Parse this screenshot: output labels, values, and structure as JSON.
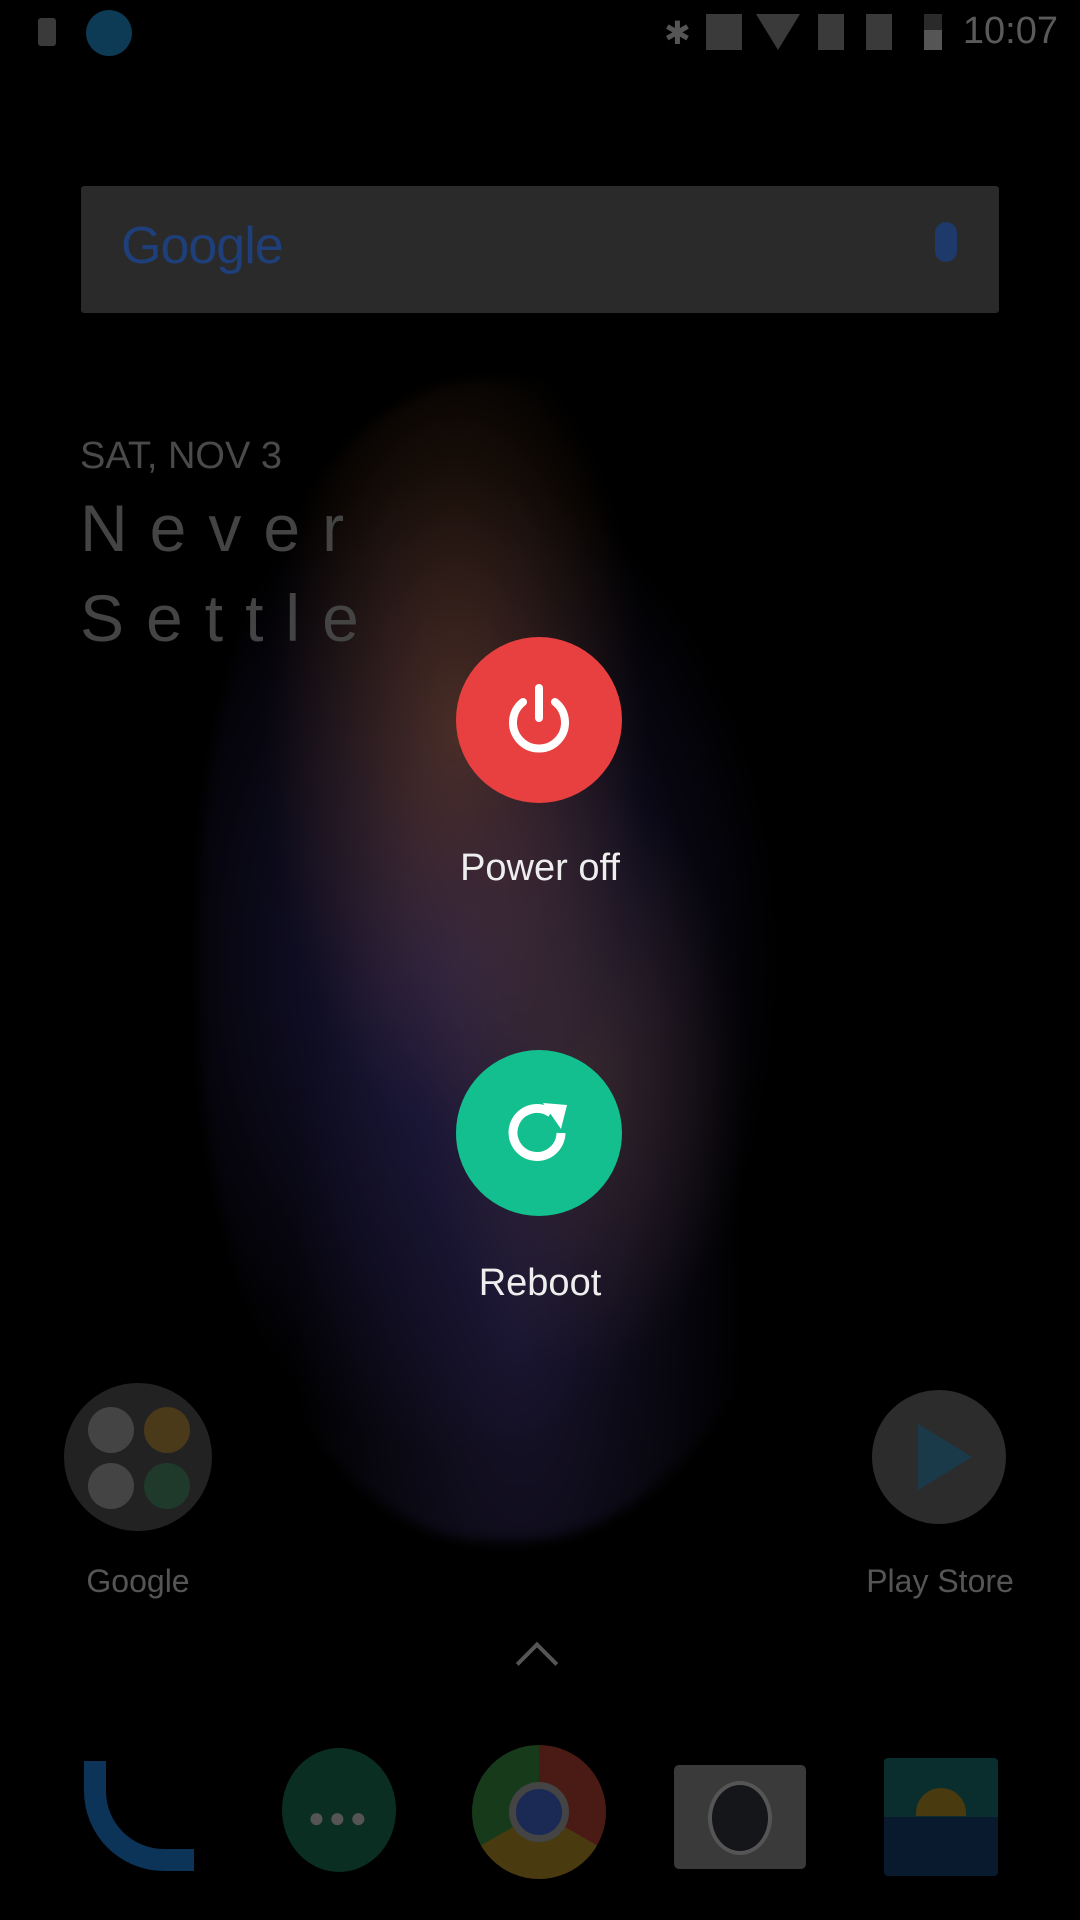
{
  "status_bar": {
    "time": "10:07",
    "icons": [
      "download-notification-icon",
      "teamviewer-icon",
      "bluetooth-icon",
      "nfc-icon",
      "wifi-icon",
      "no-sim-icon",
      "no-sim-icon",
      "battery-icon"
    ]
  },
  "search": {
    "logo": "Google",
    "mic_icon": "mic-icon"
  },
  "widget": {
    "date": "SAT, NOV 3",
    "line1": "Never",
    "line2": "Settle"
  },
  "power_menu": {
    "power_off": {
      "label": "Power off",
      "color": "#e84040",
      "icon": "power-icon"
    },
    "reboot": {
      "label": "Reboot",
      "color": "#13bf8e",
      "icon": "reboot-icon"
    }
  },
  "home_apps": [
    {
      "label": "Google"
    },
    {
      "label": "Play Store"
    }
  ],
  "dock": [
    "phone",
    "hangouts",
    "chrome",
    "camera",
    "gallery"
  ]
}
